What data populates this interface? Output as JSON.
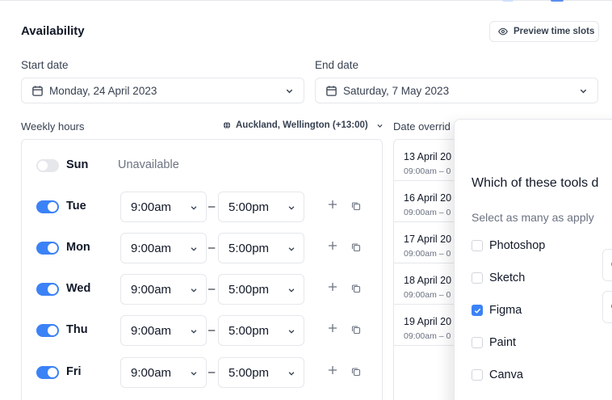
{
  "header": {
    "title": "Availability",
    "preview_button": "Preview time slots"
  },
  "dates": {
    "start_label": "Start date",
    "start_value": "Monday, 24 April 2023",
    "end_label": "End date",
    "end_value": "Saturday, 7 May 2023"
  },
  "weekly": {
    "label": "Weekly hours",
    "timezone": "Auckland, Wellington (+13:00)",
    "unavailable_text": "Unavailable",
    "days": [
      {
        "name": "Sun",
        "enabled": false
      },
      {
        "name": "Tue",
        "enabled": true,
        "start": "9:00am",
        "end": "5:00pm"
      },
      {
        "name": "Mon",
        "enabled": true,
        "start": "9:00am",
        "end": "5:00pm"
      },
      {
        "name": "Wed",
        "enabled": true,
        "start": "9:00am",
        "end": "5:00pm"
      },
      {
        "name": "Thu",
        "enabled": true,
        "start": "9:00am",
        "end": "5:00pm"
      },
      {
        "name": "Fri",
        "enabled": true,
        "start": "9:00am",
        "end": "5:00pm"
      }
    ],
    "separator": "–"
  },
  "overrides": {
    "label": "Date overrid",
    "items": [
      {
        "date": "13 April 20",
        "time": "09:00am – 0"
      },
      {
        "date": "16 April 20",
        "time": "09:00am – 0"
      },
      {
        "date": "17 April 20",
        "time": "09:00am – 0"
      },
      {
        "date": "18 April 20",
        "time": "09:00am – 0"
      },
      {
        "date": "19 April 20",
        "time": "09:00am – 0"
      }
    ]
  },
  "survey": {
    "question": "Which of these tools d",
    "subtitle": "Select as many as apply",
    "options": [
      {
        "label": "Photoshop",
        "checked": false
      },
      {
        "label": "Sketch",
        "checked": false
      },
      {
        "label": "Figma",
        "checked": true
      },
      {
        "label": "Paint",
        "checked": false
      },
      {
        "label": "Canva",
        "checked": false
      }
    ]
  },
  "colors": {
    "accent": "#3b82f6",
    "border": "#e5e7eb",
    "chip_green": "#22c55e",
    "chip_red": "#ef4444"
  },
  "icons": [
    "eye-icon",
    "calendar-icon",
    "chevron-down-icon",
    "globe-icon",
    "plus-icon",
    "copy-icon",
    "check-icon"
  ]
}
